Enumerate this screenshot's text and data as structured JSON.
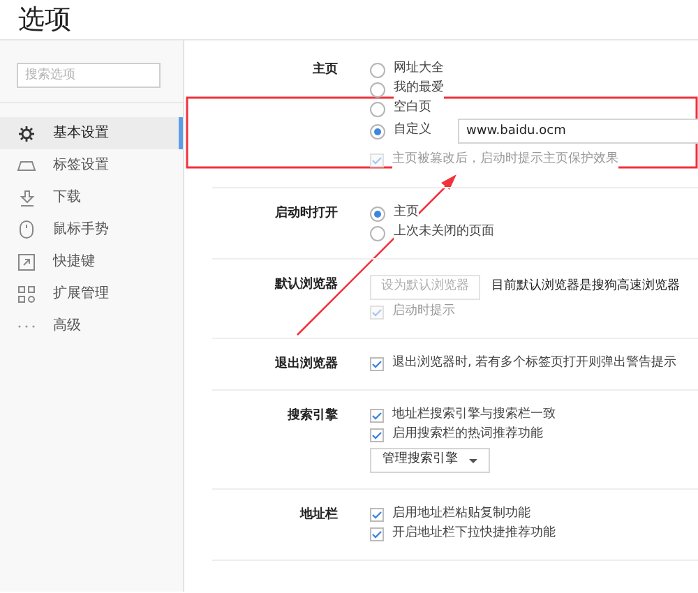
{
  "window": {
    "title": "选项"
  },
  "sidebar": {
    "search": {
      "placeholder": "搜索选项"
    },
    "items": [
      {
        "label": "基本设置",
        "selected": true
      },
      {
        "label": "标签设置",
        "selected": false
      },
      {
        "label": "下载",
        "selected": false
      },
      {
        "label": "鼠标手势",
        "selected": false
      },
      {
        "label": "快捷键",
        "selected": false
      },
      {
        "label": "扩展管理",
        "selected": false
      },
      {
        "label": "高级",
        "selected": false
      }
    ]
  },
  "sections": [
    {
      "label": "主页",
      "controls": [
        {
          "kind": "radio",
          "label": "网址大全",
          "selected": false
        },
        {
          "kind": "radio",
          "label": "我的最爱",
          "selected": false
        },
        {
          "kind": "radio",
          "label": "空白页",
          "selected": false
        },
        {
          "kind": "radio",
          "label": "自定义",
          "selected": true,
          "value": "www.baidu.ocm"
        },
        {
          "kind": "checkbox",
          "label": "主页被篡改后，启动时提示主页保护效果",
          "checked": true,
          "disabled": true
        }
      ]
    },
    {
      "label": "启动时打开",
      "controls": [
        {
          "kind": "radio",
          "label": "主页",
          "selected": true
        },
        {
          "kind": "radio",
          "label": "上次未关闭的页面",
          "selected": false
        }
      ]
    },
    {
      "label": "默认浏览器",
      "controls": [
        {
          "kind": "button",
          "label": "设为默认浏览器",
          "disabled": true,
          "note": "目前默认浏览器是搜狗高速浏览器"
        },
        {
          "kind": "checkbox",
          "label": "启动时提示",
          "checked": true,
          "disabled": true
        }
      ]
    },
    {
      "label": "退出浏览器",
      "controls": [
        {
          "kind": "checkbox",
          "label": "退出浏览器时, 若有多个标签页打开则弹出警告提示",
          "checked": true,
          "disabled": false
        }
      ]
    },
    {
      "label": "搜索引擎",
      "controls": [
        {
          "kind": "checkbox",
          "label": "地址栏搜索引擎与搜索栏一致",
          "checked": true,
          "disabled": false
        },
        {
          "kind": "checkbox",
          "label": "启用搜索栏的热词推荐功能",
          "checked": true,
          "disabled": false
        },
        {
          "kind": "dropdown",
          "label": "管理搜索引擎"
        }
      ]
    },
    {
      "label": "地址栏",
      "controls": [
        {
          "kind": "checkbox",
          "label": "启用地址栏粘贴复制功能",
          "checked": true,
          "disabled": false
        },
        {
          "kind": "checkbox",
          "label": "开启地址栏下拉快捷推荐功能",
          "checked": true,
          "disabled": false
        }
      ]
    }
  ]
}
